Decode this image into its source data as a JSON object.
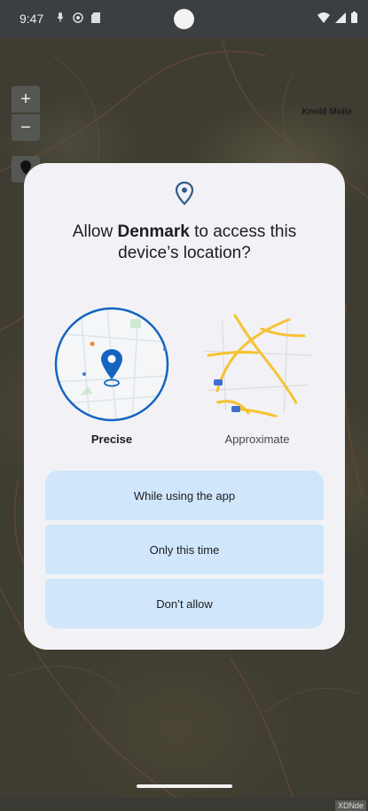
{
  "status_bar": {
    "time": "9:47",
    "icons_left": [
      "mic-icon",
      "globe-icon",
      "sim-card-icon"
    ],
    "icons_right": [
      "wifi-icon",
      "signal-icon",
      "battery-icon"
    ]
  },
  "map": {
    "zoom_in_label": "+",
    "zoom_out_label": "−",
    "place_label": "Knold Molle",
    "attribution": "XDNde",
    "locate_icon": "location-pin-icon"
  },
  "dialog": {
    "icon": "location-pin-icon",
    "title_prefix": "Allow ",
    "app_name": "Denmark",
    "title_suffix": " to access this device’s location?",
    "precise_label": "Precise",
    "approximate_label": "Approximate",
    "buttons": {
      "while_using": "While using the app",
      "only_this_time": "Only this time",
      "dont_allow": "Don’t allow"
    }
  },
  "colors": {
    "accent": "#1565c0",
    "button_bg": "#cfe6fb",
    "dialog_bg": "#f2f2f6",
    "road_yellow": "#f6c231"
  }
}
